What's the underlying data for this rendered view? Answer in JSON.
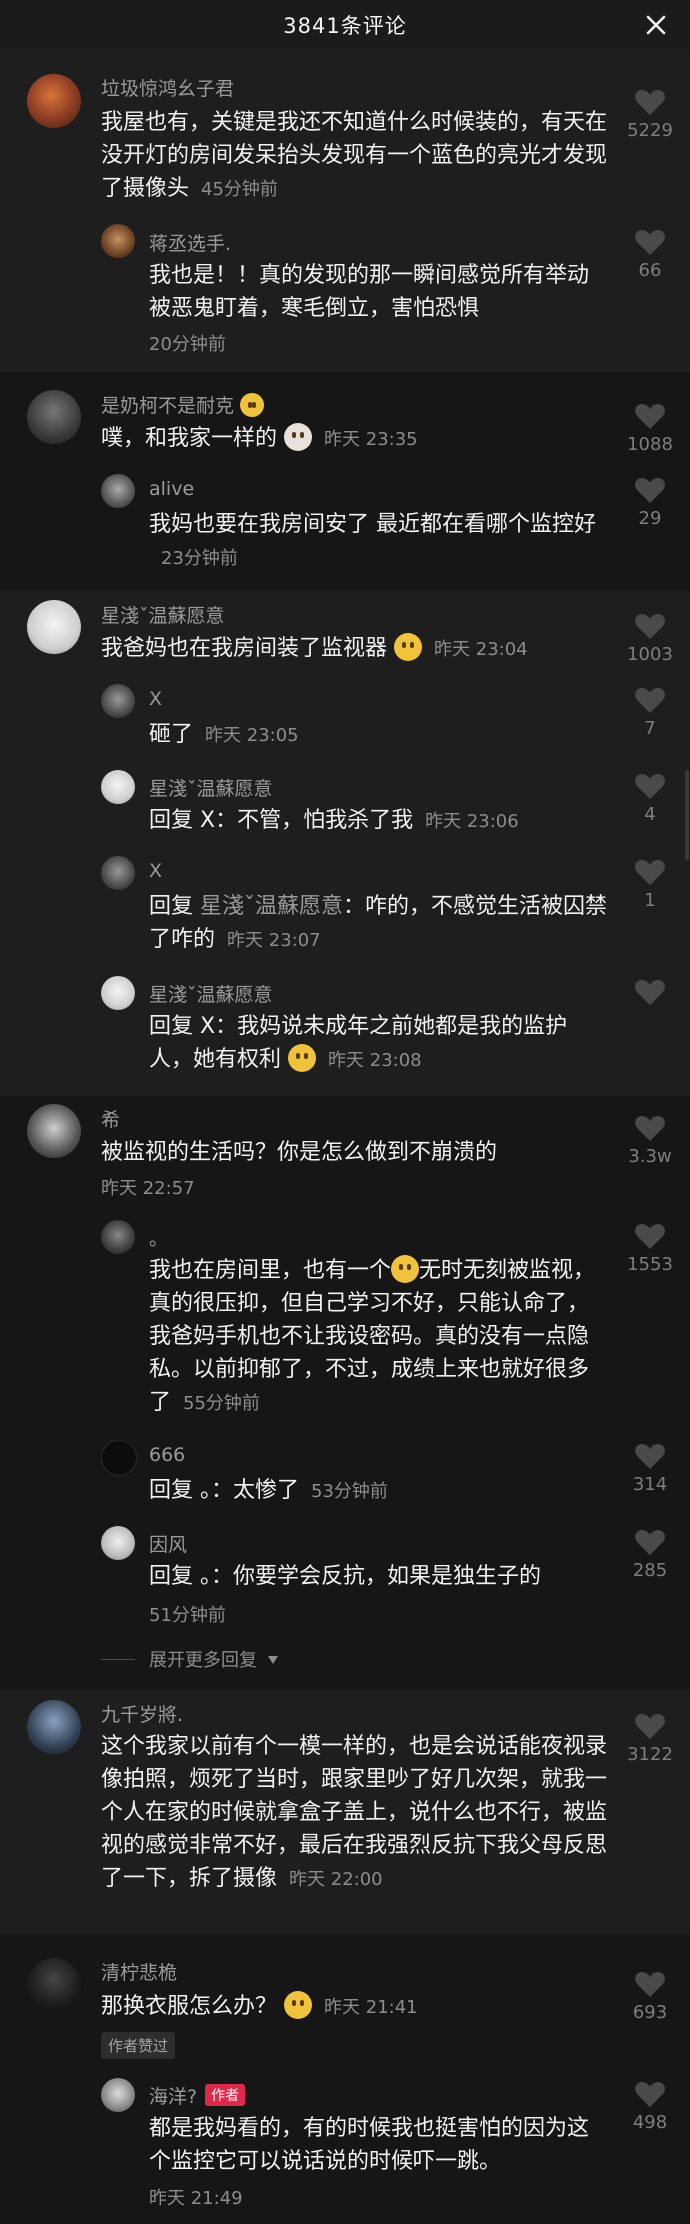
{
  "header": {
    "title": "3841条评论"
  },
  "comments": {
    "c1": {
      "name": "垃圾惊鸿幺子君",
      "text": "我屋也有，关键是我还不知道什么时候装的，有天在没开灯的房间发呆抬头发现有一个蓝色的亮光才发现了摄像头",
      "time": "45分钟前",
      "likes": "5229",
      "replies": [
        {
          "name": "蒋丞选手.",
          "text": "我也是！！真的发现的那一瞬间感觉所有举动被恶鬼盯着，寒毛倒立，害怕恐惧",
          "time": "20分钟前",
          "likes": "66"
        }
      ]
    },
    "c2": {
      "name": "是奶柯不是耐克",
      "text": "噗，和我家一样的",
      "time": "昨天 23:35",
      "likes": "1088",
      "replies": [
        {
          "name": "alive",
          "text": "我妈也要在我房间安了 最近都在看哪个监控好",
          "time": "23分钟前",
          "likes": "29"
        }
      ]
    },
    "c3": {
      "name": "星淺ˇ温蘇愿意",
      "text": "我爸妈也在我房间装了监视器",
      "time": "昨天 23:04",
      "likes": "1003",
      "replies": [
        {
          "name": "X",
          "text": "砸了",
          "time": "昨天 23:05",
          "likes": "7"
        },
        {
          "name": "星淺ˇ温蘇愿意",
          "prefix": "回复 X：",
          "text": "不管，怕我杀了我",
          "time": "昨天 23:06",
          "likes": "4"
        },
        {
          "name": "X",
          "prefix": "回复 ",
          "target": "星淺ˇ温蘇愿意",
          "text": "：咋的，不感觉生活被囚禁了咋的",
          "time": "昨天 23:07",
          "likes": "1"
        },
        {
          "name": "星淺ˇ温蘇愿意",
          "prefix": "回复 X：",
          "text": "我妈说未成年之前她都是我的监护人，她有权利",
          "time": "昨天 23:08",
          "likes": ""
        }
      ]
    },
    "c4": {
      "name": "希",
      "text": "被监视的生活吗？你是怎么做到不崩溃的",
      "time": "昨天 22:57",
      "likes": "3.3w",
      "replies": [
        {
          "name": "。",
          "text_a": "我也在房间里，也有一个",
          "text_b": "无时无刻被监视，真的很压抑，但自己学习不好，只能认命了，我爸妈手机也不让我设密码。真的没有一点隐私。以前抑郁了，不过，成绩上来也就好很多了",
          "time": "55分钟前",
          "likes": "1553"
        },
        {
          "name": "666",
          "prefix": "回复 。：",
          "text": "太惨了",
          "time": "53分钟前",
          "likes": "314"
        },
        {
          "name": "因风",
          "prefix": "回复 。：",
          "text": "你要学会反抗，如果是独生子的",
          "time": "51分钟前",
          "likes": "285"
        }
      ],
      "expand": "展开更多回复"
    },
    "c5": {
      "name": "九千岁將.",
      "text": "这个我家以前有个一模一样的，也是会说话能夜视录像拍照，烦死了当时，跟家里吵了好几次架，就我一个人在家的时候就拿盒子盖上，说什么也不行，被监视的感觉非常不好，最后在我强烈反抗下我父母反思了一下，拆了摄像",
      "time": "昨天 22:00",
      "likes": "3122"
    },
    "c6": {
      "name": "清柠悲桅",
      "text": "那换衣服怎么办？",
      "time": "昨天 21:41",
      "likes": "693",
      "liked_tag": "作者赞过",
      "replies": [
        {
          "name": "海洋?",
          "author_tag": "作者",
          "text": "都是我妈看的，有的时候我也挺害怕的因为这个监控它可以说话说的时候吓一跳。",
          "time": "昨天 21:49",
          "likes": "498"
        }
      ]
    }
  },
  "icons": {
    "close": "close-icon",
    "like": "heart-icon",
    "expand": "caret-down-icon"
  },
  "colors": {
    "background": "#161616",
    "alt_background": "#1e1e1e",
    "author_tag": "#e0294a"
  }
}
